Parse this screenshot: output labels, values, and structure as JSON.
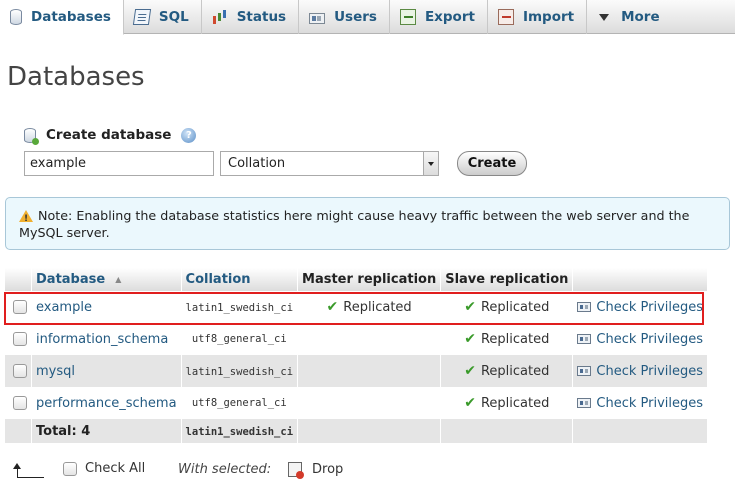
{
  "tabs": [
    {
      "label": "Databases",
      "icon": "database-icon",
      "active": true
    },
    {
      "label": "SQL",
      "icon": "sql-icon",
      "active": false
    },
    {
      "label": "Status",
      "icon": "status-chart-icon",
      "active": false
    },
    {
      "label": "Users",
      "icon": "users-icon",
      "active": false
    },
    {
      "label": "Export",
      "icon": "export-icon",
      "active": false
    },
    {
      "label": "Import",
      "icon": "import-icon",
      "active": false
    },
    {
      "label": "More",
      "icon": "dropdown-arrow-icon",
      "active": false
    }
  ],
  "page_title": "Databases",
  "create": {
    "heading": "Create database",
    "help_glyph": "?",
    "name_value": "example",
    "collation_value": "Collation",
    "button_label": "Create"
  },
  "notice": {
    "text": "Note: Enabling the database statistics here might cause heavy traffic between the web server and the MySQL server."
  },
  "table": {
    "headers": {
      "database": "Database",
      "collation": "Collation",
      "master": "Master replication",
      "slave": "Slave replication"
    },
    "rows": [
      {
        "name": "example",
        "collation": "latin1_swedish_ci",
        "master": "Replicated",
        "slave": "Replicated",
        "action": "Check Privileges"
      },
      {
        "name": "information_schema",
        "collation": "utf8_general_ci",
        "master": "",
        "slave": "Replicated",
        "action": "Check Privileges"
      },
      {
        "name": "mysql",
        "collation": "latin1_swedish_ci",
        "master": "",
        "slave": "Replicated",
        "action": "Check Privileges"
      },
      {
        "name": "performance_schema",
        "collation": "utf8_general_ci",
        "master": "",
        "slave": "Replicated",
        "action": "Check Privileges"
      }
    ],
    "total_label": "Total: 4",
    "total_collation": "latin1_swedish_ci"
  },
  "bottom": {
    "check_all": "Check All",
    "with_selected": "With selected:",
    "drop": "Drop"
  },
  "colors": {
    "link": "#235a81",
    "highlight_border": "#e01e1e",
    "notice_bg": "#ebf8fd",
    "check": "#3a9a2a"
  }
}
